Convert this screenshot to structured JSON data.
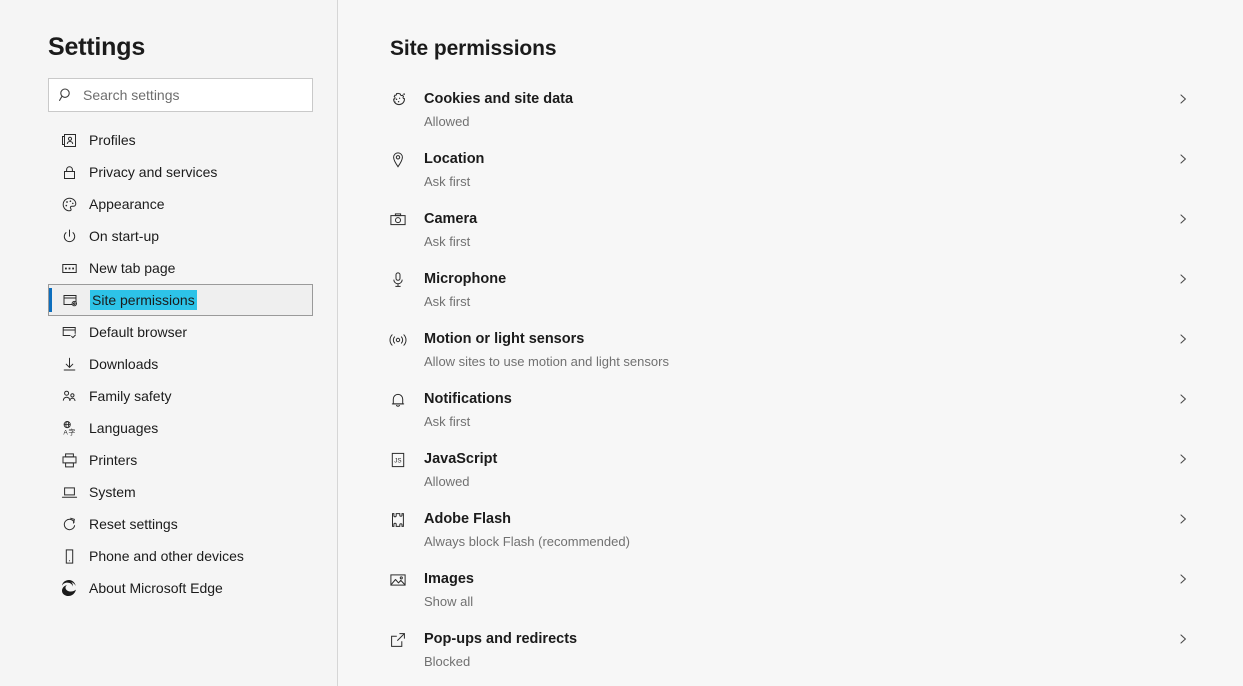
{
  "sidebar": {
    "title": "Settings",
    "search": {
      "placeholder": "Search settings",
      "value": "",
      "icon": "search-icon"
    },
    "items": [
      {
        "label": "Profiles",
        "icon": "profile-card-icon",
        "selected": false
      },
      {
        "label": "Privacy and services",
        "icon": "lock-icon",
        "selected": false
      },
      {
        "label": "Appearance",
        "icon": "palette-icon",
        "selected": false
      },
      {
        "label": "On start-up",
        "icon": "power-icon",
        "selected": false
      },
      {
        "label": "New tab page",
        "icon": "new-tab-page-icon",
        "selected": false
      },
      {
        "label": "Site permissions",
        "icon": "site-permissions-icon",
        "selected": true
      },
      {
        "label": "Default browser",
        "icon": "default-browser-icon",
        "selected": false
      },
      {
        "label": "Downloads",
        "icon": "download-arrow-icon",
        "selected": false
      },
      {
        "label": "Family safety",
        "icon": "family-icon",
        "selected": false
      },
      {
        "label": "Languages",
        "icon": "languages-icon",
        "selected": false
      },
      {
        "label": "Printers",
        "icon": "printer-icon",
        "selected": false
      },
      {
        "label": "System",
        "icon": "system-laptop-icon",
        "selected": false
      },
      {
        "label": "Reset settings",
        "icon": "reset-circular-arrow-icon",
        "selected": false
      },
      {
        "label": "Phone and other devices",
        "icon": "phone-icon",
        "selected": false
      },
      {
        "label": "About Microsoft Edge",
        "icon": "edge-logo-icon",
        "selected": false
      }
    ]
  },
  "main": {
    "title": "Site permissions",
    "permissions": [
      {
        "title": "Cookies and site data",
        "status": "Allowed",
        "icon": "cookie-icon"
      },
      {
        "title": "Location",
        "status": "Ask first",
        "icon": "location-pin-icon"
      },
      {
        "title": "Camera",
        "status": "Ask first",
        "icon": "camera-icon"
      },
      {
        "title": "Microphone",
        "status": "Ask first",
        "icon": "microphone-icon"
      },
      {
        "title": "Motion or light sensors",
        "status": "Allow sites to use motion and light sensors",
        "icon": "motion-sensor-icon"
      },
      {
        "title": "Notifications",
        "status": "Ask first",
        "icon": "bell-icon"
      },
      {
        "title": "JavaScript",
        "status": "Allowed",
        "icon": "javascript-icon"
      },
      {
        "title": "Adobe Flash",
        "status": "Always block Flash (recommended)",
        "icon": "puzzle-piece-icon"
      },
      {
        "title": "Images",
        "status": "Show all",
        "icon": "image-icon"
      },
      {
        "title": "Pop-ups and redirects",
        "status": "Blocked",
        "icon": "external-link-icon"
      }
    ],
    "row_chevron_icon": "chevron-right-icon"
  },
  "colors": {
    "accent_bar": "#0d6ebd",
    "selection_highlight": "#2dc3e8",
    "sidebar_bg": "#f5f5f5",
    "main_bg": "#f7f7f7",
    "divider": "#d6d6d6",
    "text_primary": "#1b1b1b",
    "text_secondary": "#717171"
  }
}
